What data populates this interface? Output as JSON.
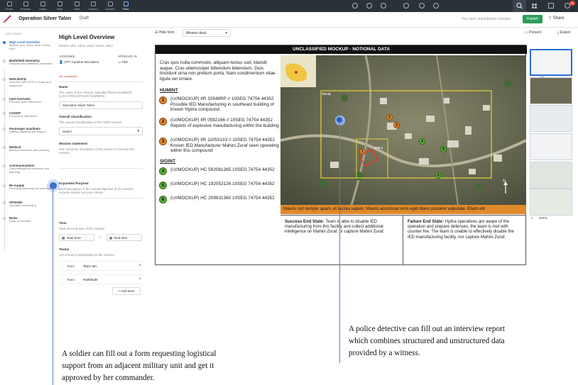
{
  "topbar": {
    "items": [
      {
        "label": "Home",
        "icon": "home-icon"
      },
      {
        "label": "Browser",
        "icon": "browser-icon"
      },
      {
        "label": "Graph",
        "icon": "graph-icon"
      },
      {
        "label": "Map",
        "icon": "map-icon"
      },
      {
        "label": "Gaia",
        "icon": "gaia-icon"
      },
      {
        "label": "Contour",
        "icon": "contour-icon"
      },
      {
        "label": "Dossier",
        "icon": "dossier-icon"
      },
      {
        "label": "Slate",
        "icon": "slate-icon"
      }
    ],
    "notification_count": "99"
  },
  "header": {
    "title": "Operation Silver Talon",
    "status": "Draft",
    "unsaved": "You have unpublished changes",
    "publish": "Publish",
    "share": "Share"
  },
  "sidebar": {
    "heading": "SECTIONS",
    "items": [
      {
        "title": "High Level Overview",
        "desc": "Mission who, when, what, where, why?"
      },
      {
        "title": "Battlefield Geometry",
        "desc": "Describe key battlefield landmarks"
      },
      {
        "title": "INFIL/EXFIL",
        "desc": "Describe INFIL/EXFIL routes and waypoints"
      },
      {
        "title": "Intel Overview",
        "desc": "IPM and other references"
      },
      {
        "title": "CONOP",
        "desc": "Concept of operations"
      },
      {
        "title": "Passenger manifests",
        "desc": "Staffing planning and support"
      },
      {
        "title": "Medical",
        "desc": "Medical resources and planning"
      },
      {
        "title": "Communications",
        "desc": "Communications resources and planning"
      },
      {
        "title": "Re-supply",
        "desc": "Re-supply planning and schedule"
      },
      {
        "title": "OPSKED",
        "desc": "Operation scheduling"
      },
      {
        "title": "Risks",
        "desc": "Risks to consider"
      }
    ]
  },
  "form": {
    "title": "High Level Overview",
    "subtitle": "Mission who, when, what, where, why?",
    "assignee_label": "ASSIGNEE",
    "assignee": "CPT Caroline McAdams",
    "appears_label": "APPEARS IN",
    "appears": "Title",
    "progress": "3/4 completed",
    "name_label": "Name",
    "name_desc": "The name of the mission, typically [TEAM NUMBER] [LOCATION] [OTHER NUMBER]",
    "name_value": "Operation Silver Talon",
    "class_label": "Overall classification",
    "class_desc": "The overall classification of the entire mission.",
    "class_value": "Select",
    "stmt_label": "Mission statement",
    "stmt_desc": "One sentence description of the reason to execute this mission.",
    "purpose_label": "Expanded Purpose",
    "purpose_desc": "Brief description of the overall objective of the mission. Include mission success criteria.",
    "time_label": "Time",
    "time_desc": "Start and end time of the mission.",
    "start_time": "Start time",
    "end_time": "End time",
    "teams_label": "Teams",
    "teams_desc": "List of teams participating in the mission.",
    "teams": [
      {
        "key": "Team",
        "value": "Team MC"
      },
      {
        "key": "Team",
        "value": "Pathfinder"
      }
    ],
    "add_team": "Add team"
  },
  "toolbar": {
    "hide_form": "Hide form",
    "deck": "Mission deck",
    "present": "Present",
    "export": "Export"
  },
  "slide": {
    "title": "UNCLASSIFIED MOCKUP - NOTIONAL DATA",
    "intro": "Cras quis nulla commodo, aliquam lectus sed, blandit augue. Cras ullamcorper bibendum bibendum. Duis tincidunt urna non pretium porta. Nam condimentum vitae ligula vel ornare.",
    "humint_heading": "HUMINT",
    "humint": [
      {
        "n": "1",
        "text": "(U//MOCKUP) IIR 32948RP // 10SEG 74754 44352 Possible IED Manufacturing in southeast building of known Hydra compound"
      },
      {
        "n": "2",
        "text": "(U//MOCKUP) IIR 0592166 // 10SEG 74754 44352 Reports of explosive manufacturing within the building"
      },
      {
        "n": "3",
        "text": "(U//MOCKUP) IIR 11053133 // 10SEG 74754 44352 Known IED Manufacturer Mahini Zuraf seen operating within this compound"
      }
    ],
    "sigint_heading": "SIGINT",
    "sigint": [
      {
        "n": "4",
        "text": "(U//MOCKUP) HC 592081265 10SEG 74754 44352"
      },
      {
        "n": "5",
        "text": "(U//MOCKUP) HC 192053126 10SEG 74754 44352"
      },
      {
        "n": "6",
        "text": "(U//MOCKUP) HC 209631360 10SEG 74754 44352"
      }
    ],
    "map_labels": {
      "tai": "TAI 01",
      "cdi": "CDI 1",
      "north": "N"
    },
    "banner": "Mauris non tempor quam, et lacinia sapien. Mauris accumsan eros eget libero posuere vulputate. Etiam elit",
    "success_title": "Success End State:",
    "success_text": "Team is able to disable IED manufacturing from this facility and collect additional intelligence on Mahini Zuraf, or capture Mahini Zuraf.",
    "failure_title": "Failure End State:",
    "failure_text": "Hydra operatives are aware of the operation and prepare defenses, the team is met with counter fire. The team is unable to effectively disable the IED manufacturing facility, nor capture Mahini Zuraf."
  },
  "thumbs": [
    {
      "n": "1",
      "label": "Title"
    },
    {
      "n": "2",
      "label": "CONOP"
    },
    {
      "n": "3",
      "label": "Resupply"
    },
    {
      "n": "4",
      "label": "Communications"
    },
    {
      "n": "5",
      "label": "INFIL"
    },
    {
      "n": "6",
      "label": "EXFIL"
    }
  ],
  "captions": {
    "left": "A soldier can fill out a form requesting logistical support from an adjacent military unit and get it approved by her commander.",
    "right": "A police detective can fill out an interview report which combines structured and unstructured data provided by a witness."
  },
  "colors": {
    "accent": "#2a6fd6",
    "publish": "#2e9c5a",
    "marker_orange": "#e0892b",
    "marker_green": "#5cae3b",
    "topbar": "#2b3138"
  }
}
